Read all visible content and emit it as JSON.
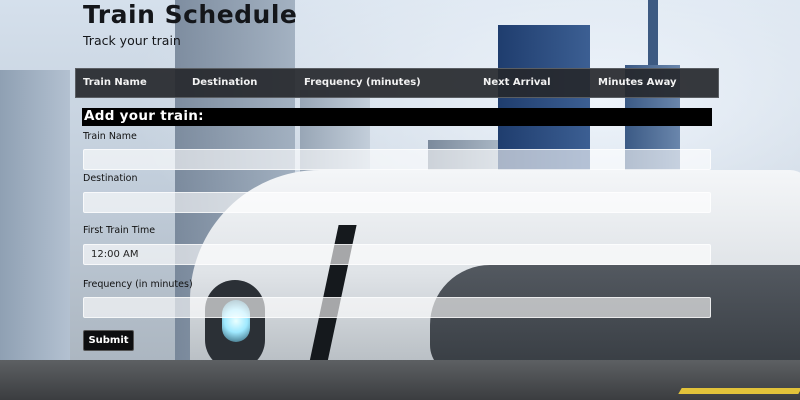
{
  "header": {
    "title": "Train Schedule",
    "subtitle": "Track your train"
  },
  "schedule_table": {
    "columns": [
      "Train Name",
      "Destination",
      "Frequency (minutes)",
      "Next Arrival",
      "Minutes Away"
    ],
    "rows": []
  },
  "form": {
    "title": "Add your train:",
    "fields": {
      "train_name": {
        "label": "Train Name",
        "value": ""
      },
      "destination": {
        "label": "Destination",
        "value": ""
      },
      "first_train_time": {
        "label": "First Train Time",
        "value": "12:00 AM"
      },
      "frequency": {
        "label": "Frequency (in minutes)",
        "value": ""
      }
    },
    "submit_label": "Submit"
  },
  "colors": {
    "table_header_bg": "#26282c",
    "form_header_bg": "#000000",
    "button_bg": "#0d0e10"
  }
}
